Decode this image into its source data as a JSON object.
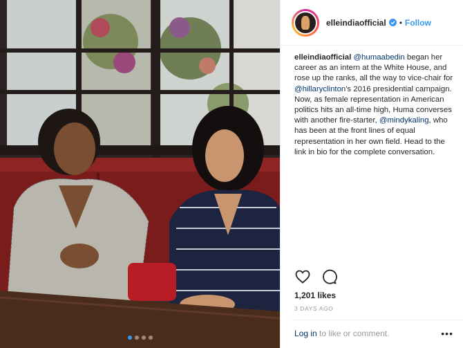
{
  "post": {
    "username": "elleindiaofficial",
    "verified_icon": "verified-badge-icon",
    "separator": "•",
    "follow_label": "Follow",
    "caption": {
      "user": "elleindiaofficial",
      "mention1": "@humaabedin",
      "text1": " began her career as an intern at the White House, and rose up the ranks, all the way to vice-chair for ",
      "mention2": "@hillaryclinton",
      "text2": "'s 2016 presidential campaign. Now, as female representation in American politics hits an all-time high, Huma converses with another fire-starter, ",
      "mention3": "@mindykaling",
      "text3": ", who has been at the front lines of equal representation in her own field. Head to the link in bio for the complete conversation."
    },
    "likes": "1,201 likes",
    "timestamp": "3 DAYS AGO",
    "comment_login": "Log in",
    "comment_rest": " to like or comment.",
    "more_label": "•••",
    "carousel": {
      "count": 4,
      "active": 1
    }
  },
  "colors": {
    "accent": "#3897f0",
    "mention": "#003569",
    "text": "#262626",
    "muted": "#999999"
  }
}
